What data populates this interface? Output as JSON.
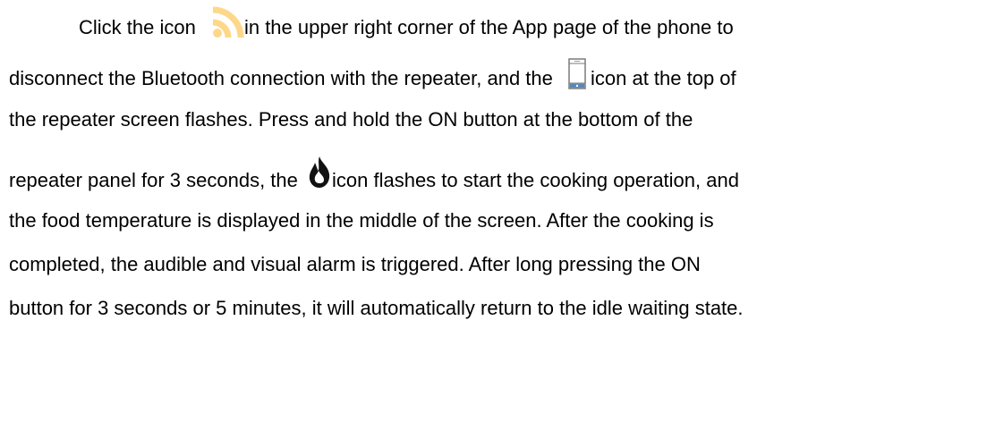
{
  "paragraph": {
    "line1": {
      "before": "Click the icon ",
      "icon": "wifi-signal-icon",
      "after": "in the upper right corner of the App page of the phone to"
    },
    "line2": {
      "before": "disconnect the Bluetooth connection with the repeater, and the ",
      "icon": "phone-icon",
      "after": "icon at the top of"
    },
    "line3": {
      "text": "the repeater screen flashes. Press and hold the ON button at the bottom of the"
    },
    "line4": {
      "before": "repeater panel for 3 seconds, the ",
      "icon": "flame-icon",
      "after": "icon flashes to start the cooking operation, and"
    },
    "line5": {
      "text": "the food temperature is displayed in the middle of the screen. After the cooking is"
    },
    "line6": {
      "text": "completed, the audible and visual alarm is triggered. After long pressing the ON"
    },
    "line7": {
      "text": "button for 3 seconds or 5 minutes, it will automatically return to the idle waiting state."
    }
  },
  "colors": {
    "text": "#000000",
    "wifi_icon": "#FDD88A",
    "background": "#FFFFFF"
  }
}
